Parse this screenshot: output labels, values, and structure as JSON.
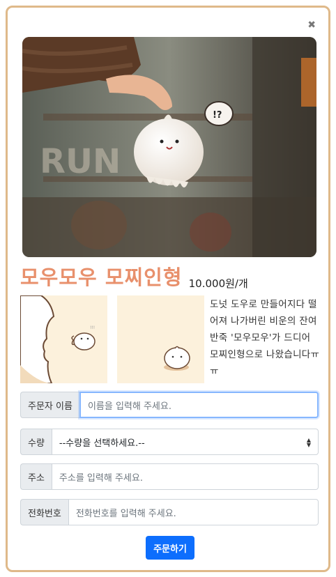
{
  "product": {
    "title": "모우모우 모찌인형",
    "price": "10.000원/개",
    "description": "도넛 도우로 만들어지다 떨어져 나가버린 비운의 잔여반죽 '모우모우'가 드디어 모찌인형으로 나왔습니다ㅠㅠ",
    "bubble_text": "!?"
  },
  "form": {
    "name_label": "주문자 이름",
    "name_placeholder": "이름을 입력해 주세요.",
    "qty_label": "수량",
    "qty_selected": "--수량을 선택하세요.--",
    "address_label": "주소",
    "address_placeholder": "주소를 입력해 주세요.",
    "phone_label": "전화번호",
    "phone_placeholder": "전화번호를 입력해 주세요.",
    "submit_label": "주문하기"
  },
  "icons": {
    "close": "close-icon",
    "select_caret": "sort-arrows-icon"
  },
  "colors": {
    "modal_border": "#dfb98a",
    "title": "#e8906c",
    "button": "#0d6efd",
    "focus_border": "#86b7fe"
  }
}
